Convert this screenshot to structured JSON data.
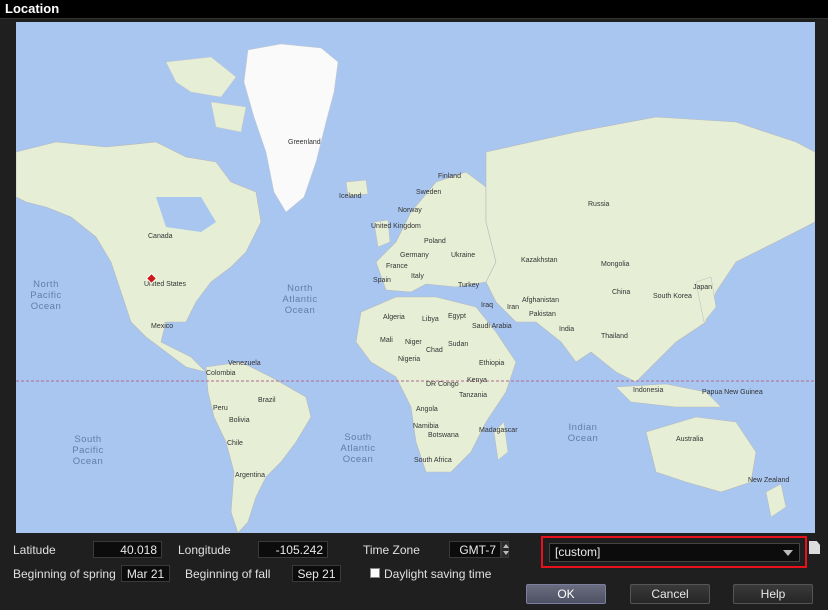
{
  "window": {
    "title": "Location"
  },
  "map": {
    "country_labels": [
      "Greenland",
      "Iceland",
      "Finland",
      "Sweden",
      "Norway",
      "United Kingdom",
      "Poland",
      "Germany",
      "Ukraine",
      "France",
      "Spain",
      "Italy",
      "Turkey",
      "Russia",
      "Kazakhstan",
      "Mongolia",
      "China",
      "South Korea",
      "Japan",
      "Canada",
      "United States",
      "Mexico",
      "Venezuela",
      "Colombia",
      "Brazil",
      "Peru",
      "Bolivia",
      "Chile",
      "Argentina",
      "Algeria",
      "Libya",
      "Egypt",
      "Mali",
      "Niger",
      "Chad",
      "Sudan",
      "Nigeria",
      "Ethiopia",
      "DR Congo",
      "Kenya",
      "Tanzania",
      "Angola",
      "Namibia",
      "Botswana",
      "South Africa",
      "Madagascar",
      "Iraq",
      "Iran",
      "Saudi Arabia",
      "Afghanistan",
      "Pakistan",
      "India",
      "Thailand",
      "Indonesia",
      "Papua New Guinea",
      "Australia",
      "New Zealand"
    ],
    "ocean_labels": {
      "north_pacific": [
        "North",
        "Pacific",
        "Ocean"
      ],
      "north_atlantic": [
        "North",
        "Atlantic",
        "Ocean"
      ],
      "south_pacific": [
        "South",
        "Pacific",
        "Ocean"
      ],
      "south_atlantic": [
        "South",
        "Atlantic",
        "Ocean"
      ],
      "indian": [
        "Indian",
        "Ocean"
      ]
    },
    "marker_icon": "location-pin-icon"
  },
  "form": {
    "latitude_label": "Latitude",
    "latitude_value": "40.018",
    "longitude_label": "Longitude",
    "longitude_value": "-105.242",
    "timezone_label": "Time Zone",
    "timezone_value": "GMT-7",
    "location_select_value": "[custom]",
    "spring_label": "Beginning of spring",
    "spring_value": "Mar 21",
    "fall_label": "Beginning of fall",
    "fall_value": "Sep 21",
    "dst_label": "Daylight saving time",
    "dst_checked": false
  },
  "buttons": {
    "ok": "OK",
    "cancel": "Cancel",
    "help": "Help"
  },
  "colors": {
    "ocean": "#a8c6f0",
    "land": "#e6efd6",
    "highlight_border": "#e8101a",
    "ok_button": "#5a5c72"
  }
}
